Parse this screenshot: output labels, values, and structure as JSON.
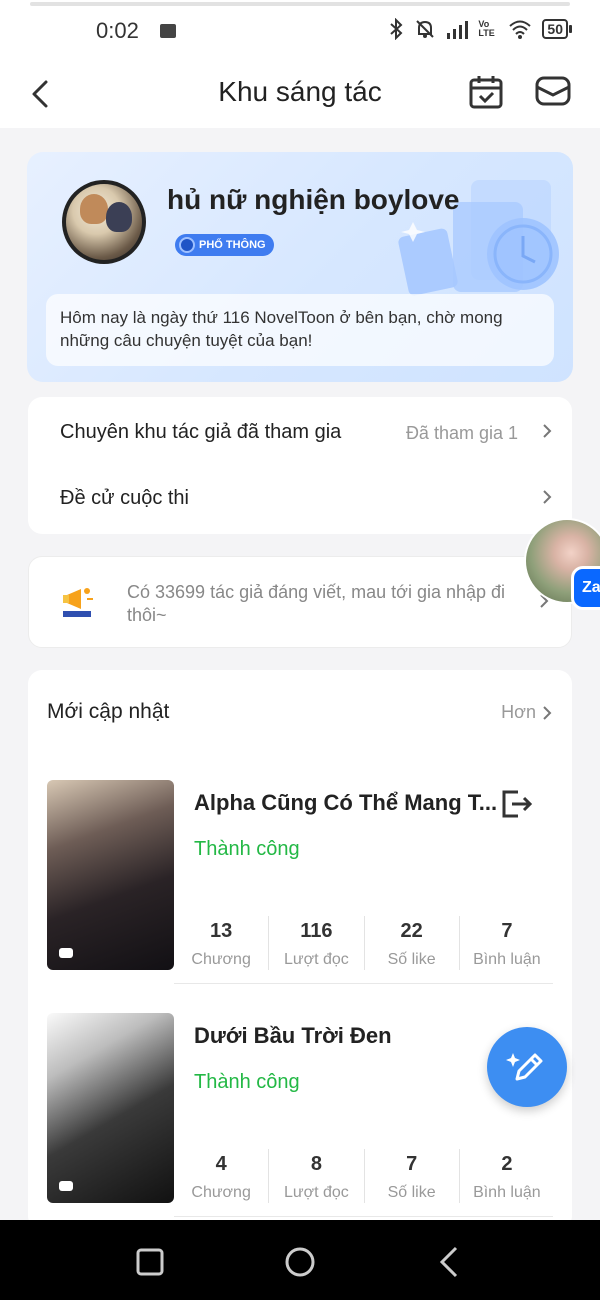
{
  "status_bar": {
    "time": "0:02",
    "battery": "50",
    "network": "Vo LTE",
    "icons": [
      "gallery-icon",
      "bluetooth-icon",
      "mute-icon",
      "signal-icon",
      "wifi-icon",
      "battery-icon"
    ]
  },
  "header": {
    "title": "Khu sáng tác",
    "icons": [
      "back-icon",
      "calendar-icon",
      "mail-icon"
    ]
  },
  "profile": {
    "username": "hủ nữ nghiện boylove",
    "badge": "PHỔ THÔNG",
    "welcome_message": "Hôm nay là ngày thứ 116 NovelToon ở bên bạn, chờ mong những câu chuyện tuyệt của bạn!"
  },
  "menu": {
    "items": [
      {
        "label": "Chuyên khu tác giả đã tham gia",
        "value": "Đã tham gia 1"
      },
      {
        "label": "Đề cử cuộc thi",
        "value": ""
      }
    ]
  },
  "promo": {
    "text": "Có 33699 tác giả đáng viết, mau tới gia nhập đi thôi~",
    "icon": "megaphone-icon"
  },
  "floating": {
    "zalo_label": "Za"
  },
  "updates": {
    "title": "Mới cập nhật",
    "more_label": "Hơn",
    "stories": [
      {
        "title": "Alpha Cũng Có Thể Mang T...",
        "status": "Thành công",
        "stats": [
          {
            "value": "13",
            "label": "Chương"
          },
          {
            "value": "116",
            "label": "Lượt đọc"
          },
          {
            "value": "22",
            "label": "Số like"
          },
          {
            "value": "7",
            "label": "Bình luận"
          }
        ]
      },
      {
        "title": "Dưới Bầu Trời Đen",
        "status": "Thành công",
        "stats": [
          {
            "value": "4",
            "label": "Chương"
          },
          {
            "value": "8",
            "label": "Lượt đọc"
          },
          {
            "value": "7",
            "label": "Số like"
          },
          {
            "value": "2",
            "label": "Bình luận"
          }
        ]
      }
    ]
  },
  "colors": {
    "accent": "#3d8ef2",
    "success": "#23b845",
    "badge": "#3f7cf0"
  }
}
